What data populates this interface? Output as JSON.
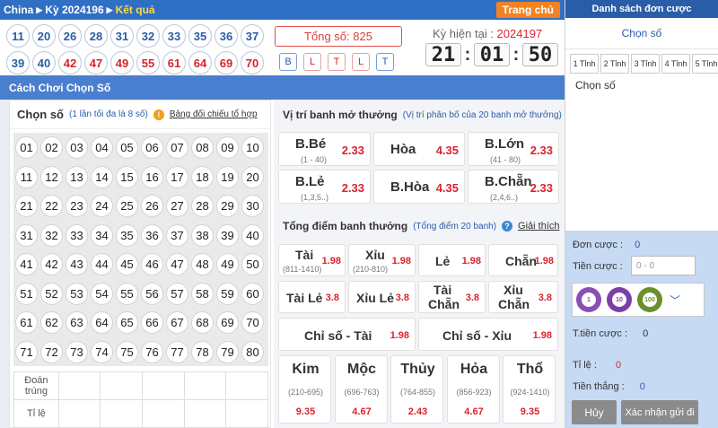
{
  "topbar": {
    "region": "China",
    "ky": "Kỳ 2024196",
    "result": "Kết quả",
    "home": "Trang chủ"
  },
  "balls": [
    {
      "n": "11",
      "red": false
    },
    {
      "n": "20",
      "red": false
    },
    {
      "n": "26",
      "red": false
    },
    {
      "n": "28",
      "red": false
    },
    {
      "n": "31",
      "red": false
    },
    {
      "n": "32",
      "red": false
    },
    {
      "n": "33",
      "red": false
    },
    {
      "n": "35",
      "red": false
    },
    {
      "n": "36",
      "red": false
    },
    {
      "n": "37",
      "red": false
    },
    {
      "n": "39",
      "red": false
    },
    {
      "n": "40",
      "red": false
    },
    {
      "n": "42",
      "red": true
    },
    {
      "n": "47",
      "red": true
    },
    {
      "n": "49",
      "red": true
    },
    {
      "n": "55",
      "red": true
    },
    {
      "n": "61",
      "red": true
    },
    {
      "n": "64",
      "red": true
    },
    {
      "n": "69",
      "red": true
    },
    {
      "n": "70",
      "red": true
    }
  ],
  "total": "Tổng số: 825",
  "result_tags": [
    {
      "t": "B",
      "c": "b"
    },
    {
      "t": "L",
      "c": "r"
    },
    {
      "t": "T",
      "c": "r"
    },
    {
      "t": "L",
      "c": "r"
    },
    {
      "t": "T",
      "c": "b"
    }
  ],
  "current": {
    "label": "Kỳ hiện tại : ",
    "value": "2024197"
  },
  "clock": {
    "h": "21",
    "m": "01",
    "s": "50"
  },
  "play_bar": "Cách Chơi Chọn Số",
  "pick": {
    "title": "Chọn số",
    "note": "(1 lần tối đa là 8 số)",
    "info": "!",
    "link": "Bảng đối chiếu tổ hợp",
    "numbers": [
      "01",
      "02",
      "03",
      "04",
      "05",
      "06",
      "07",
      "08",
      "09",
      "10",
      "11",
      "12",
      "13",
      "14",
      "15",
      "16",
      "17",
      "18",
      "19",
      "20",
      "21",
      "22",
      "23",
      "24",
      "25",
      "26",
      "27",
      "28",
      "29",
      "30",
      "31",
      "32",
      "33",
      "34",
      "35",
      "36",
      "37",
      "38",
      "39",
      "40",
      "41",
      "42",
      "43",
      "44",
      "45",
      "46",
      "47",
      "48",
      "49",
      "50",
      "51",
      "52",
      "53",
      "54",
      "55",
      "56",
      "57",
      "58",
      "59",
      "60",
      "61",
      "62",
      "63",
      "64",
      "65",
      "66",
      "67",
      "68",
      "69",
      "70",
      "71",
      "72",
      "73",
      "74",
      "75",
      "76",
      "77",
      "78",
      "79",
      "80"
    ],
    "row1": "Đoán trúng",
    "row2": "Tỉ lệ"
  },
  "position": {
    "title": "Vị trí banh mở thưởng",
    "note": "(Vị trí phân bố của 20 banh mở thưởng)",
    "cells": [
      {
        "name": "B.Bé",
        "sub": "(1 - 40)",
        "odd": "2.33"
      },
      {
        "name": "Hòa",
        "sub": "",
        "odd": "4.35"
      },
      {
        "name": "B.Lớn",
        "sub": "(41 - 80)",
        "odd": "2.33"
      },
      {
        "name": "B.Lẻ",
        "sub": "(1,3,5..)",
        "odd": "2.33"
      },
      {
        "name": "B.Hòa",
        "sub": "",
        "odd": "4.35"
      },
      {
        "name": "B.Chẵn",
        "sub": "(2,4,6..)",
        "odd": "2.33"
      }
    ]
  },
  "sum": {
    "title": "Tổng điểm banh thưởng",
    "note": "(Tổng điểm 20 banh)",
    "help": "?",
    "link": "Giải thích",
    "row1": [
      {
        "name": "Tài",
        "sub": "(811-1410)",
        "odd": "1.98"
      },
      {
        "name": "Xỉu",
        "sub": "(210-810)",
        "odd": "1.98"
      },
      {
        "name": "Lẻ",
        "sub": "",
        "odd": "1.98"
      },
      {
        "name": "Chẵn",
        "sub": "",
        "odd": "1.98"
      }
    ],
    "row2": [
      {
        "name": "Tài Lẻ",
        "odd": "3.8"
      },
      {
        "name": "Xỉu Lẻ",
        "odd": "3.8"
      },
      {
        "name1": "Tài",
        "name2": "Chẵn",
        "odd": "3.8"
      },
      {
        "name1": "Xỉu",
        "name2": "Chẵn",
        "odd": "3.8"
      }
    ],
    "row3": [
      {
        "name": "Chỉ số - Tài",
        "odd": "1.98"
      },
      {
        "name": "Chỉ số - Xỉu",
        "odd": "1.98"
      }
    ],
    "row4": [
      {
        "name": "Kim",
        "sub": "(210-695)",
        "odd": "9.35"
      },
      {
        "name": "Mộc",
        "sub": "(696-763)",
        "odd": "4.67"
      },
      {
        "name": "Thủy",
        "sub": "(764-855)",
        "odd": "2.43"
      },
      {
        "name": "Hỏa",
        "sub": "(856-923)",
        "odd": "4.67"
      },
      {
        "name": "Thổ",
        "sub": "(924-1410)",
        "odd": "9.35"
      }
    ]
  },
  "slip": {
    "title": "Danh sách đơn cược",
    "pick": "Chọn số",
    "tinh": [
      "1 Tỉnh",
      "2 Tỉnh",
      "3 Tỉnh",
      "4 Tỉnh",
      "5 Tỉnh"
    ],
    "chon_so": "Chọn số",
    "orders_label": "Đơn cược :",
    "orders": "0",
    "money_label": "Tiền cược :",
    "money_ph": "0 - 0",
    "chips": [
      "1",
      "10",
      "100"
    ],
    "total_label": "T.tiền cược :",
    "total": "0",
    "rate_label": "Tỉ lệ :",
    "rate": "0",
    "win_label": "Tiền thắng :",
    "win": "0",
    "cancel": "Hủy",
    "confirm": "Xác nhận gửi đi"
  }
}
